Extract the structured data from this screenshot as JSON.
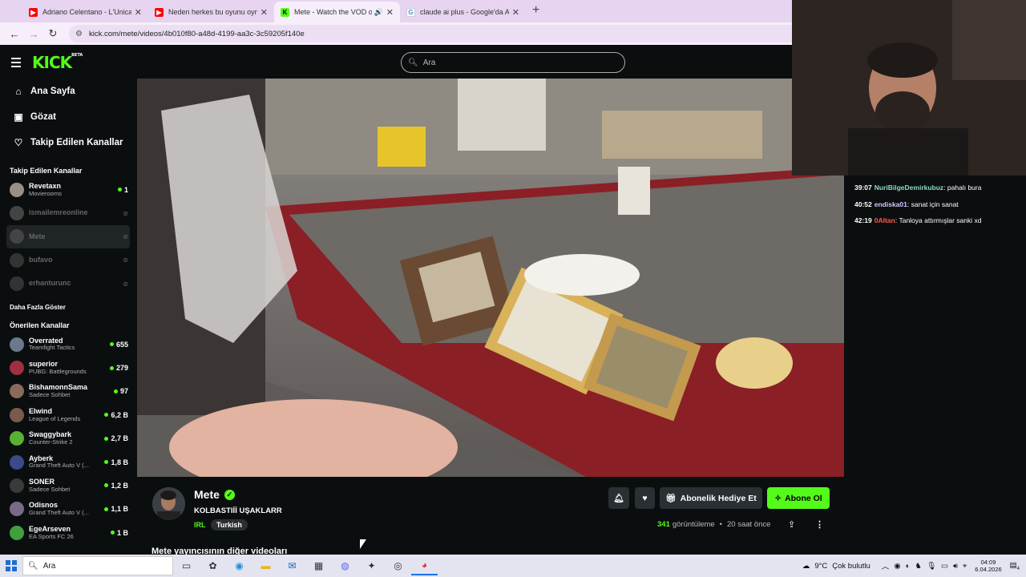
{
  "browser": {
    "tabs": [
      {
        "title": "Adriano Celentano - L'Unica Ch",
        "fav": "youtube-icon",
        "color": "#ff0000"
      },
      {
        "title": "Neden herkes bu oyunu oynam",
        "fav": "youtube-icon",
        "color": "#ff0000"
      },
      {
        "title": "Mete - Watch the VOD on K",
        "fav": "kick-icon",
        "color": "#53fc18",
        "active": true
      },
      {
        "title": "claude ai plus - Google'da Ara",
        "fav": "google-icon",
        "color": "#4285f4"
      }
    ],
    "url": "kick.com/mete/videos/4b010f80-a48d-4199-aa3c-3c59205f140e"
  },
  "header": {
    "logo": "KICK",
    "logo_badge": "BETA",
    "search_placeholder": "Ara"
  },
  "sidebar": {
    "nav": [
      {
        "label": "Ana Sayfa",
        "icon": "home-icon"
      },
      {
        "label": "Gözat",
        "icon": "browse-icon"
      },
      {
        "label": "Takip Edilen Kanallar",
        "icon": "heart-icon"
      }
    ],
    "followed_title": "Takip Edilen Kanallar",
    "followed": [
      {
        "name": "Revetaxn",
        "game": "Movierooms",
        "viewers": "1",
        "online": true
      },
      {
        "name": "ismailemreonline",
        "online": false
      },
      {
        "name": "Mete",
        "online": false,
        "selected": true
      },
      {
        "name": "bufavo",
        "online": false
      },
      {
        "name": "erhanturunc",
        "online": false
      }
    ],
    "show_more": "Daha Fazla Göster",
    "recommended_title": "Önerilen Kanallar",
    "recommended": [
      {
        "name": "Overrated",
        "game": "Teamfight Tactics",
        "viewers": "655"
      },
      {
        "name": "superior",
        "game": "PUBG: Battlegrounds",
        "viewers": "279"
      },
      {
        "name": "BishamonnSama",
        "game": "Sadece Sohbet",
        "viewers": "97"
      },
      {
        "name": "Elwind",
        "game": "League of Legends",
        "viewers": "6,2 B"
      },
      {
        "name": "Swaggybark",
        "game": "Counter-Strike 2",
        "viewers": "2,7 B"
      },
      {
        "name": "Ayberk",
        "game": "Grand Theft Auto V (...",
        "viewers": "1,8 B"
      },
      {
        "name": "SONER",
        "game": "Sadece Sohbet",
        "viewers": "1,2 B"
      },
      {
        "name": "Odisnos",
        "game": "Grand Theft Auto V (...",
        "viewers": "1,1 B"
      },
      {
        "name": "EgeArseven",
        "game": "EA Sports FC 26",
        "viewers": "1 B"
      }
    ]
  },
  "chat": [
    {
      "time": "39:07",
      "user": "NuriBilgeDemirkubuz",
      "color": "#8fd9c8",
      "text": "pahalı bura"
    },
    {
      "time": "40:52",
      "user": "endiska01",
      "color": "#cfc8ff",
      "text": "sanat için sanat"
    },
    {
      "time": "42:19",
      "user": "0Altan",
      "color": "#ff5a4a",
      "text": "Tanloya attırmışlar sanki xd"
    }
  ],
  "video_info": {
    "channel": "Mete",
    "title": "KOLBASTIİİ UŞAKLARR",
    "category": "IRL",
    "tag": "Turkish",
    "gift_button": "Abonelik Hediye Et",
    "subscribe_button": "Abone Ol",
    "views": "341",
    "views_label": "görüntüleme",
    "age": "20 saat önce",
    "other_videos": "Mete yayıncısının diğer videoları"
  },
  "taskbar": {
    "search": "Ara",
    "weather": "9°C",
    "weather_text": "Çok bulutlu",
    "time": "04:09",
    "date": "6.04.2026",
    "notifications": "4"
  }
}
